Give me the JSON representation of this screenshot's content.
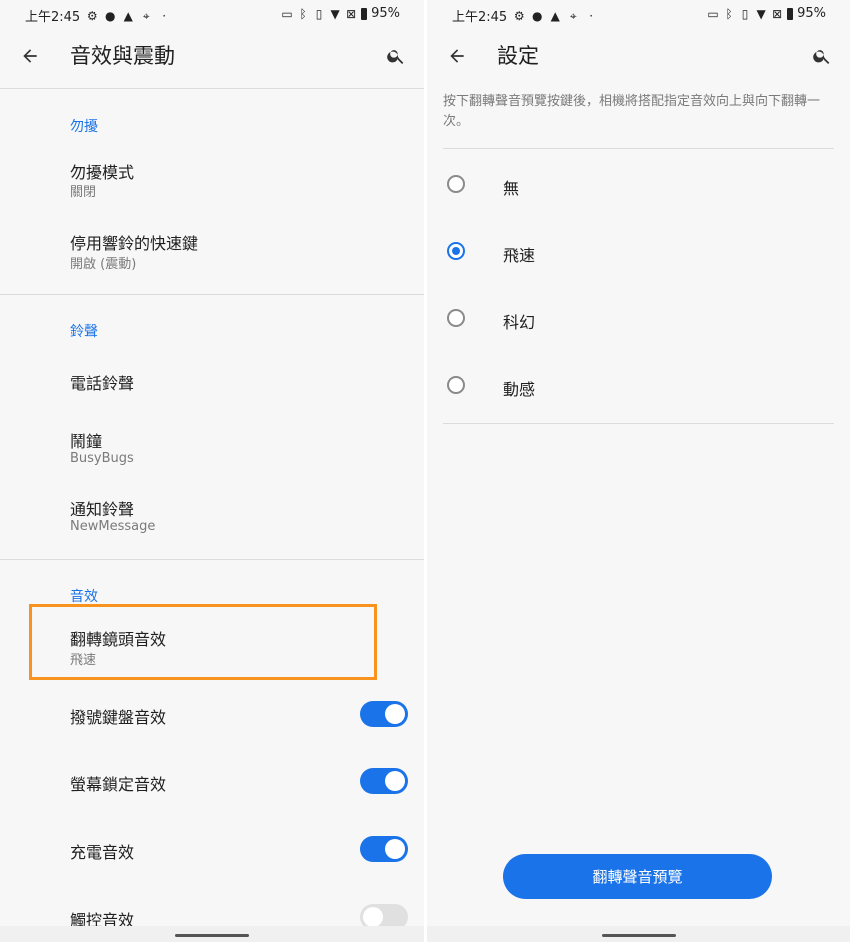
{
  "left": {
    "status": {
      "time": "上午2:45",
      "battery": "95%"
    },
    "appbar": {
      "title": "音效與震動"
    },
    "sections": {
      "dnd_label": "勿擾",
      "ringtone_label": "鈴聲",
      "sound_label": "音效"
    },
    "items": {
      "dnd_mode": {
        "title": "勿擾模式",
        "sub": "關閉"
      },
      "mute_shortcut": {
        "title": "停用響鈴的快速鍵",
        "sub": "開啟 (震動)"
      },
      "phone_ringtone": {
        "title": "電話鈴聲"
      },
      "alarm": {
        "title": "鬧鐘",
        "sub": "BusyBugs"
      },
      "notification": {
        "title": "通知鈴聲",
        "sub": "NewMessage"
      },
      "flip_camera": {
        "title": "翻轉鏡頭音效",
        "sub": "飛速"
      },
      "dial_pad": {
        "title": "撥號鍵盤音效",
        "on": true
      },
      "screen_lock": {
        "title": "螢幕鎖定音效",
        "on": true
      },
      "charging": {
        "title": "充電音效",
        "on": true
      },
      "touch": {
        "title": "觸控音效",
        "on": false
      }
    }
  },
  "right": {
    "status": {
      "time": "上午2:45",
      "battery": "95%"
    },
    "appbar": {
      "title": "設定"
    },
    "description": "按下翻轉聲音預覽按鍵後，相機將搭配指定音效向上與向下翻轉一次。",
    "options": [
      {
        "label": "無",
        "checked": false
      },
      {
        "label": "飛速",
        "checked": true
      },
      {
        "label": "科幻",
        "checked": false
      },
      {
        "label": "動感",
        "checked": false
      }
    ],
    "preview_button": "翻轉聲音預覽"
  },
  "colors": {
    "accent": "#1a73e8",
    "highlight": "#f7931e"
  }
}
